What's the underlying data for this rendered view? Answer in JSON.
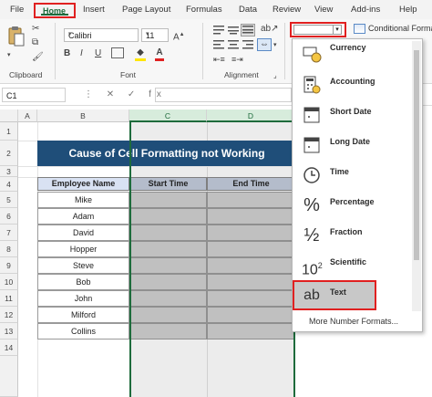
{
  "menu": {
    "items": [
      "File",
      "Home",
      "Insert",
      "Page Layout",
      "Formulas",
      "Data",
      "Review",
      "View",
      "Add-ins",
      "Help"
    ]
  },
  "ribbon": {
    "font_name": "Calibri",
    "font_size": "11",
    "groups": [
      "Clipboard",
      "Font",
      "Alignment"
    ],
    "conditional_formatting": "Conditional Forma"
  },
  "formula_bar": {
    "name_box": "C1",
    "symbols": "⋮ ✕ ✓ fx"
  },
  "sheet": {
    "columns": [
      "A",
      "B",
      "C",
      "D"
    ],
    "rows": [
      "1",
      "2",
      "3",
      "4",
      "5",
      "6",
      "7",
      "8",
      "9",
      "10",
      "11",
      "12",
      "13",
      "14"
    ],
    "title": "Cause of Cell Formatting not Working",
    "headers": [
      "Employee Name",
      "Start Time",
      "End Time"
    ],
    "employees": [
      "Mike",
      "Adam",
      "David",
      "Hopper",
      "Steve",
      "Bob",
      "John",
      "Milford",
      "Collins"
    ]
  },
  "number_format_dropdown": {
    "items": [
      {
        "label": "Currency",
        "icon": "currency-icon"
      },
      {
        "label": "Accounting",
        "icon": "accounting-icon"
      },
      {
        "label": "Short Date",
        "icon": "calendar-icon"
      },
      {
        "label": "Long Date",
        "icon": "calendar-icon"
      },
      {
        "label": "Time",
        "icon": "clock-icon"
      },
      {
        "label": "Percentage",
        "icon": "percent-icon"
      },
      {
        "label": "Fraction",
        "icon": "fraction-icon"
      },
      {
        "label": "Scientific",
        "icon": "scientific-icon"
      },
      {
        "label": "Text",
        "icon": "text-ab-icon"
      }
    ],
    "more": "More Number Formats..."
  },
  "colors": {
    "accent": "#1e6b3c",
    "title_fill": "#1f4e79",
    "header_fill": "#d9e2f3",
    "highlight": "#e02020"
  }
}
